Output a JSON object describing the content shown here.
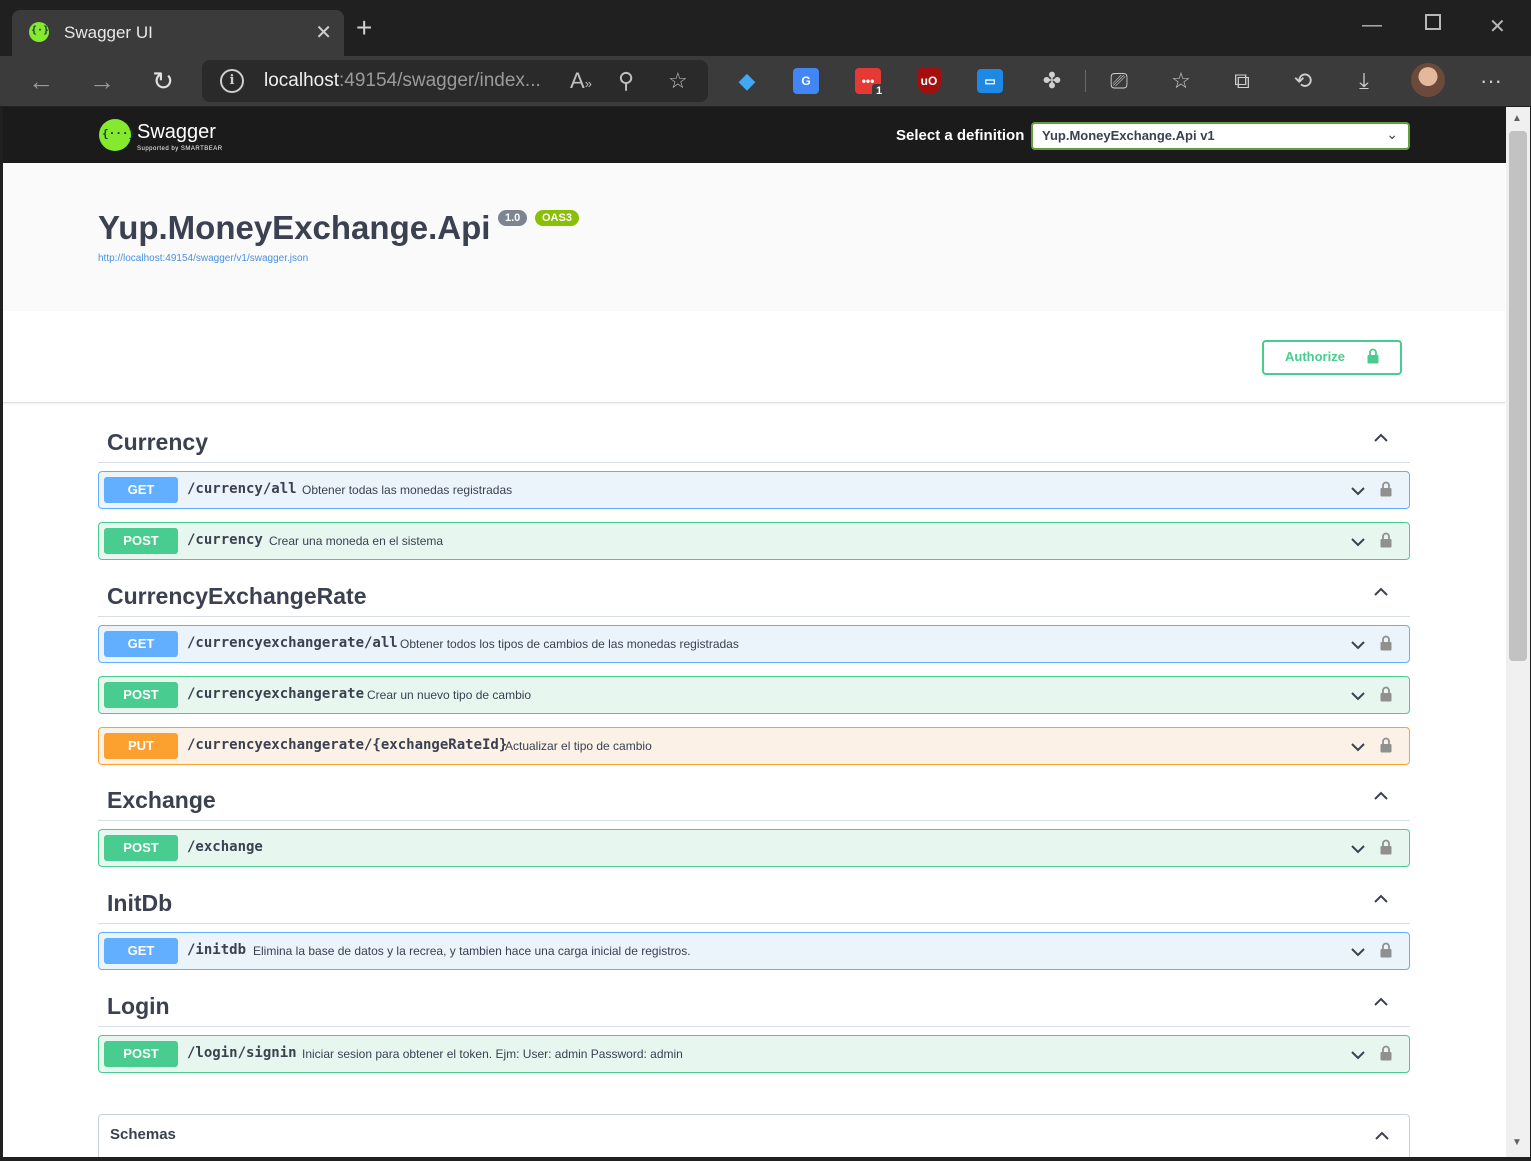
{
  "browser": {
    "tab_title": "Swagger UI",
    "url_host": "localhost",
    "url_rest": ":49154/swagger/index...",
    "extension_badge": "1",
    "icons": [
      "back-arrow-icon",
      "forward-arrow-icon",
      "refresh-icon",
      "info-icon",
      "read-aloud-icon",
      "zoom-out-icon",
      "add-favorite-icon",
      "extensions-icon",
      "cast-icon",
      "favorites-icon",
      "collections-icon",
      "history-icon",
      "download-icon",
      "more-icon"
    ]
  },
  "topbar": {
    "logo_text": "Swagger",
    "logo_sub": "Supported by SMARTBEAR",
    "definition_label": "Select a definition",
    "definition_value": "Yup.MoneyExchange.Api v1"
  },
  "info": {
    "title": "Yup.MoneyExchange.Api",
    "version": "1.0",
    "oas": "OAS3",
    "spec_url": "http://localhost:49154/swagger/v1/swagger.json"
  },
  "authorize": {
    "label": "Authorize"
  },
  "tags": [
    {
      "name": "Currency",
      "operations": [
        {
          "method": "GET",
          "path": "/currency/all",
          "summary": "Obtener todas las monedas registradas"
        },
        {
          "method": "POST",
          "path": "/currency",
          "summary": "Crear una moneda en el sistema"
        }
      ]
    },
    {
      "name": "CurrencyExchangeRate",
      "operations": [
        {
          "method": "GET",
          "path": "/currencyexchangerate/all",
          "summary": "Obtener todos los tipos de cambios de las monedas registradas"
        },
        {
          "method": "POST",
          "path": "/currencyexchangerate",
          "summary": "Crear un nuevo tipo de cambio"
        },
        {
          "method": "PUT",
          "path": "/currencyexchangerate/{exchangeRateId}",
          "summary": "Actualizar el tipo de cambio"
        }
      ]
    },
    {
      "name": "Exchange",
      "operations": [
        {
          "method": "POST",
          "path": "/exchange",
          "summary": ""
        }
      ]
    },
    {
      "name": "InitDb",
      "operations": [
        {
          "method": "GET",
          "path": "/initdb",
          "summary": "Elimina la base de datos y la recrea, y tambien hace una carga inicial de registros."
        }
      ]
    },
    {
      "name": "Login",
      "operations": [
        {
          "method": "POST",
          "path": "/login/signin",
          "summary": "Iniciar sesion para obtener el token. Ejm: User: admin Password: admin"
        }
      ]
    }
  ],
  "schemas": {
    "title": "Schemas"
  },
  "colors": {
    "get": "#61affe",
    "post": "#49cc90",
    "put": "#fca130",
    "swagger_green": "#85ea2d"
  }
}
